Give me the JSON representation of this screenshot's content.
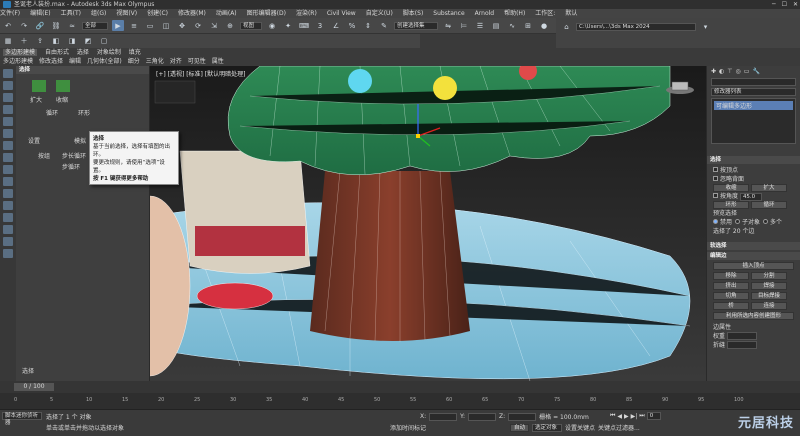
{
  "window": {
    "title": "圣诞老人装扮.max - Autodesk 3ds Max Olympus"
  },
  "menu": [
    "文件(F)",
    "编辑(E)",
    "工具(T)",
    "组(G)",
    "视图(V)",
    "创建(C)",
    "修改器(M)",
    "动画(A)",
    "图形编辑器(D)",
    "渲染(R)",
    "Civil View",
    "自定义(U)",
    "脚本(S)",
    "Substance",
    "Arnold",
    "帮助(H)",
    "工作区:",
    "默认"
  ],
  "toolbar": {
    "selection_filter": "全部",
    "view_dropdown": "视图",
    "named_selection_placeholder": "创建选择集",
    "right_path": "C:\\Users\\...\\3ds Max 2024"
  },
  "ribbon": {
    "tabs": [
      "多边形建模",
      "自由形式",
      "选择",
      "对象绘制",
      "填充"
    ],
    "active_tab": "多边形建模",
    "subtabs": [
      "多边形建模",
      "修改选择",
      "编辑",
      "几何体(全部)",
      "细分",
      "三角化",
      "对齐",
      "可见性",
      "属性"
    ]
  },
  "scene_panel": {
    "header": "选择",
    "labels": [
      "扩大",
      "收缩",
      "循环",
      "环形",
      "按组",
      "选择"
    ],
    "controls": [
      "设置",
      "模拟",
      "选择",
      "步长循环",
      "步循环"
    ]
  },
  "tooltip": {
    "title": "选择",
    "line1": "基于当前选择，选择有填图的出环。",
    "line2": "要更改规则，请使用“选项”设置。",
    "line3": "按 F1 键获得更多帮助"
  },
  "cmd_panel": {
    "dropdown": "修改器列表",
    "stack_item": "可编辑多边形",
    "select_title": "选择",
    "by_vertex": "按顶点",
    "ignore_backfacing": "忽略背面",
    "by_angle": "按角度",
    "angle_value": "45.0",
    "shrink": "收缩",
    "grow": "扩大",
    "ring": "环形",
    "loop": "循环",
    "preview_label": "预览选择",
    "preview_off": "禁用",
    "preview_sub": "子对象",
    "preview_multi": "多个",
    "selected_info": "选择了 20 个边",
    "soft_select_title": "软选择",
    "edit_edges_title": "编辑边",
    "insert_vertex": "插入顶点",
    "remove": "移除",
    "split": "分割",
    "extrude": "挤出",
    "weld": "焊接",
    "chamfer": "切角",
    "target_weld": "目标焊接",
    "bridge": "桥",
    "connect": "连接",
    "create_shape": "利用所选内容创建图形",
    "edge_props": "边属性",
    "weight_label": "权重",
    "crease_label": "折缝"
  },
  "viewport": {
    "label": "[+] [透视] [标准] [默认明暗处理]"
  },
  "timeline": {
    "frame_display": "0 / 100",
    "ticks": [
      "0",
      "5",
      "10",
      "15",
      "20",
      "25",
      "30",
      "35",
      "40",
      "45",
      "50",
      "55",
      "60",
      "65",
      "70",
      "75",
      "80",
      "85",
      "90",
      "95",
      "100"
    ]
  },
  "status": {
    "script_box": "脚本迷你侦听器",
    "selected": "选择了 1 个 对象",
    "hint": "单击或单击并拖动以选择对象",
    "x_label": "X:",
    "y_label": "Y:",
    "z_label": "Z:",
    "grid": "栅格 = 100.0mm",
    "auto_key": "自动",
    "selected_obj": "选定对象",
    "set_key": "设置关键点",
    "key_filters": "关键点过滤器...",
    "add_time_tag": "添加时间标记",
    "frame_field": "0"
  },
  "watermark": "元居科技"
}
